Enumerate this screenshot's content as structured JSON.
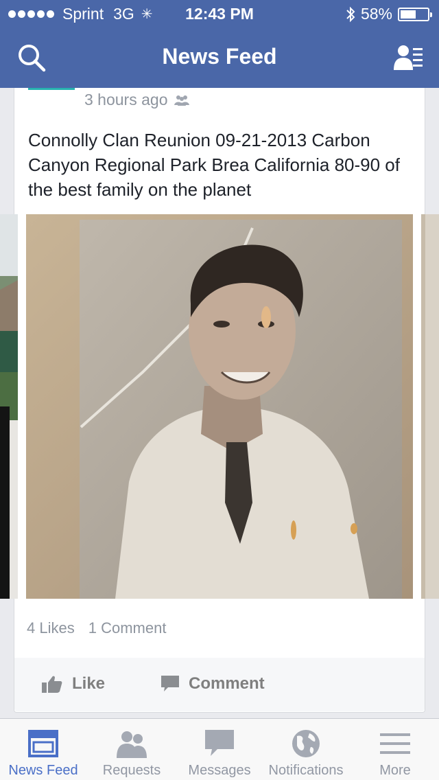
{
  "status_bar": {
    "carrier": "Sprint",
    "network": "3G",
    "time": "12:43 PM",
    "battery_percent": "58%",
    "battery_level": 0.58
  },
  "nav": {
    "title": "News Feed",
    "left_icon": "search-icon",
    "right_icon": "friends-list-icon"
  },
  "post": {
    "timestamp": "3 hours ago",
    "audience_icon": "friends-audience-icon",
    "text": "Connolly Clan Reunion 09-21-2013 Carbon Canyon Regional Park Brea California 80-90 of the best family on the planet",
    "likes": "4 Likes",
    "comments": "1 Comment",
    "like_label": "Like",
    "comment_label": "Comment"
  },
  "tabs": [
    {
      "label": "News Feed",
      "icon": "news-feed-icon",
      "active": true
    },
    {
      "label": "Requests",
      "icon": "requests-icon",
      "active": false
    },
    {
      "label": "Messages",
      "icon": "messages-icon",
      "active": false
    },
    {
      "label": "Notifications",
      "icon": "globe-icon",
      "active": false
    },
    {
      "label": "More",
      "icon": "menu-icon",
      "active": false
    }
  ],
  "colors": {
    "brand": "#4a67a8",
    "active_tab": "#4a6fc7",
    "muted_text": "#8d949e"
  }
}
